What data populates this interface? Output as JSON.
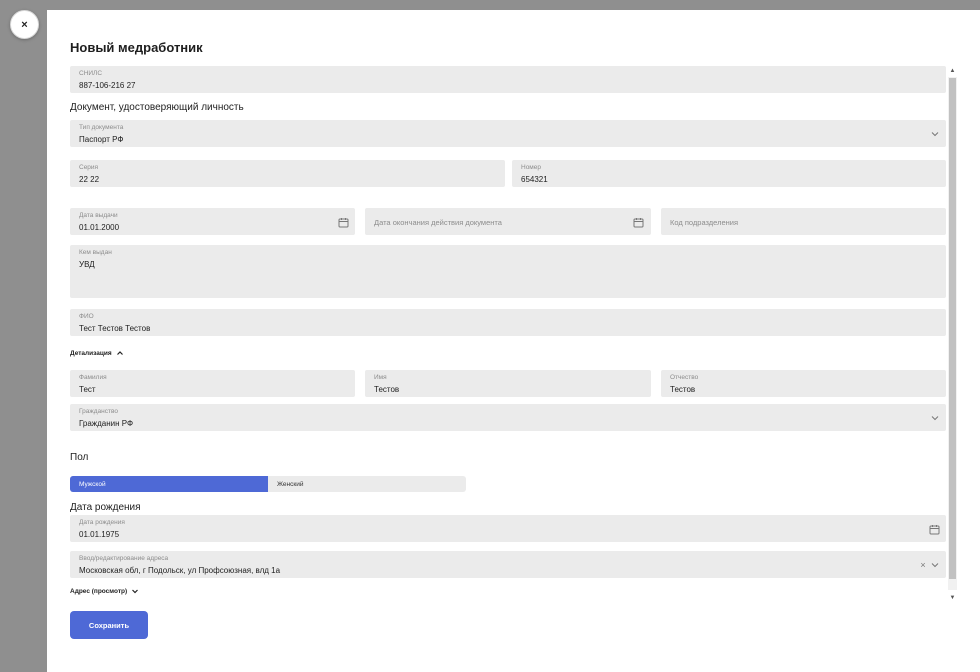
{
  "dialog": {
    "title": "Новый медработник",
    "close_label": "×",
    "save_label": "Сохранить"
  },
  "snils": {
    "label": "СНИЛС",
    "value": "887-106-216 27"
  },
  "document_section": "Документ, удостоверяющий личность",
  "doc_type": {
    "label": "Тип документа",
    "value": "Паспорт РФ"
  },
  "series": {
    "label": "Серия",
    "value": "22 22"
  },
  "number": {
    "label": "Номер",
    "value": "654321"
  },
  "issue_date": {
    "label": "Дата выдачи",
    "value": "01.01.2000"
  },
  "expiry_date": {
    "placeholder": "Дата окончания действия документа"
  },
  "division_code": {
    "placeholder": "Код подразделения"
  },
  "issued_by": {
    "label": "Кем выдан",
    "value": "УВД"
  },
  "fio": {
    "label": "ФИО",
    "value": "Тест Тестов Тестов"
  },
  "details_toggle": "Детализация",
  "surname": {
    "label": "Фамилия",
    "value": "Тест"
  },
  "name": {
    "label": "Имя",
    "value": "Тестов"
  },
  "patronymic": {
    "label": "Отчество",
    "value": "Тестов"
  },
  "citizenship": {
    "label": "Гражданство",
    "value": "Гражданин РФ"
  },
  "gender_section": "Пол",
  "gender": {
    "options": [
      "Мужской",
      "Женский"
    ],
    "selected": "Мужской"
  },
  "birth_section": "Дата рождения",
  "birth_date": {
    "label": "Дата рождения",
    "value": "01.01.1975"
  },
  "address_input": {
    "label": "Ввод/редактирование адреса",
    "value": "Московская обл, г Подольск, ул Профсоюзная, влд 1а"
  },
  "address_view_toggle": "Адрес (просмотр)",
  "colors": {
    "accent": "#4e69d6",
    "field_bg": "#ebebeb",
    "backdrop": "#8f8f8f"
  },
  "icons": [
    "close-icon",
    "chevron-down-icon",
    "calendar-icon",
    "chevron-up-icon",
    "clear-icon",
    "scroll-up-arrow-icon",
    "scroll-down-arrow-icon"
  ]
}
